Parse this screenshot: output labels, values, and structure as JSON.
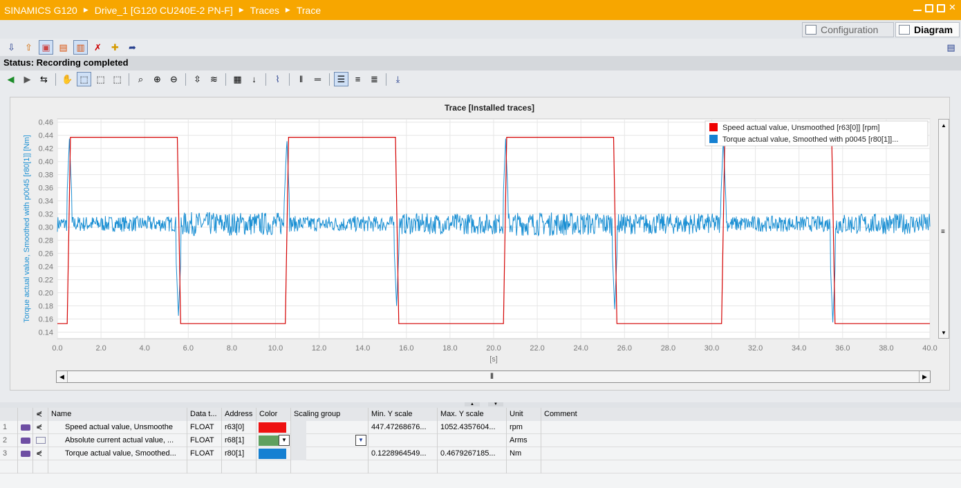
{
  "breadcrumb": [
    "SINAMICS G120",
    "Drive_1 [G120 CU240E-2 PN-F]",
    "Traces",
    "Trace"
  ],
  "view_tabs": {
    "configuration": "Configuration",
    "diagram": "Diagram"
  },
  "status": "Status: Recording completed",
  "chart_data": {
    "type": "line",
    "title": "Trace [Installed traces]",
    "ylabel": "Torque actual value, Smoothed with p0045 [r80[1]] [Nm]",
    "xlabel": "[s]",
    "xlim": [
      0,
      40
    ],
    "ylim": [
      0.13,
      0.465
    ],
    "x_ticks": [
      "0.0",
      "2.0",
      "4.0",
      "6.0",
      "8.0",
      "10.0",
      "12.0",
      "14.0",
      "16.0",
      "18.0",
      "20.0",
      "22.0",
      "24.0",
      "26.0",
      "28.0",
      "30.0",
      "32.0",
      "34.0",
      "36.0",
      "38.0",
      "40.0"
    ],
    "y_ticks": [
      "0.46",
      "0.44",
      "0.42",
      "0.40",
      "0.38",
      "0.36",
      "0.34",
      "0.32",
      "0.30",
      "0.28",
      "0.26",
      "0.24",
      "0.22",
      "0.20",
      "0.18",
      "0.16",
      "0.14"
    ],
    "grid": true,
    "legend_position": "top-right",
    "series": [
      {
        "name": "Speed actual value, Unsmoothed [r63[0]] [rpm]",
        "color": "#d40000",
        "x": [
          0,
          0.45,
          0.6,
          5.5,
          5.65,
          10.45,
          10.6,
          15.5,
          15.65,
          20.45,
          20.6,
          25.5,
          25.65,
          30.45,
          30.6,
          35.5,
          35.65,
          40
        ],
        "y": [
          0.153,
          0.153,
          0.437,
          0.437,
          0.153,
          0.153,
          0.437,
          0.437,
          0.153,
          0.153,
          0.437,
          0.437,
          0.153,
          0.153,
          0.437,
          0.437,
          0.153,
          0.153
        ]
      },
      {
        "name": "Torque actual value, Smoothed with p0045 [r80[1]]...",
        "color": "#1a8fd3",
        "baseline": 0.305,
        "noise_segments": [
          [
            0,
            5.5,
            0.012
          ],
          [
            5.5,
            10.5,
            0.018
          ],
          [
            10.5,
            15.5,
            0.012
          ],
          [
            15.5,
            20.5,
            0.016
          ],
          [
            20.5,
            25.5,
            0.018
          ],
          [
            25.5,
            30.5,
            0.016
          ],
          [
            30.5,
            35.5,
            0.012
          ],
          [
            35.5,
            40,
            0.016
          ]
        ],
        "spikes_up": [
          [
            0.55,
            0.435
          ],
          [
            10.52,
            0.435
          ],
          [
            20.55,
            0.435
          ],
          [
            30.53,
            0.435
          ]
        ],
        "spikes_down": [
          [
            5.55,
            0.165
          ],
          [
            15.55,
            0.18
          ],
          [
            25.55,
            0.175
          ],
          [
            35.55,
            0.155
          ]
        ]
      }
    ]
  },
  "signal_table": {
    "headers": [
      "Name",
      "Data t...",
      "Address",
      "Color",
      "Scaling group",
      "Min. Y scale",
      "Max. Y scale",
      "Unit",
      "Comment"
    ],
    "rows": [
      {
        "num": "1",
        "name": "Speed actual value, Unsmoothe",
        "type": "FLOAT",
        "address": "r63[0]",
        "color": "#ee1111",
        "min": "447.47268676...",
        "max": "1052.4357604...",
        "unit": "rpm",
        "comment": ""
      },
      {
        "num": "2",
        "name": "Absolute current actual value, ...",
        "type": "FLOAT",
        "address": "r68[1]",
        "color": "#5fa05f",
        "min": "",
        "max": "",
        "unit": "Arms",
        "comment": ""
      },
      {
        "num": "3",
        "name": "Torque actual value, Smoothed...",
        "type": "FLOAT",
        "address": "r80[1]",
        "color": "#1580d2",
        "min": "0.1228964549...",
        "max": "0.4679267185...",
        "unit": "Nm",
        "comment": ""
      }
    ]
  }
}
